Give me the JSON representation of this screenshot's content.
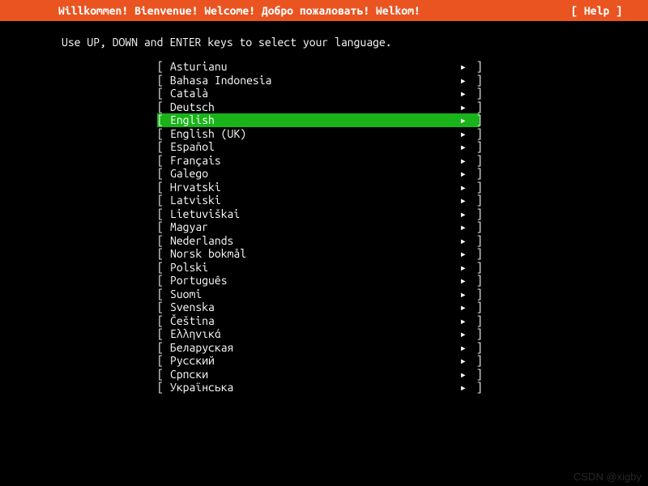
{
  "header": {
    "title": "Willkommen! Bienvenue! Welcome! Добро пожаловать! Welkom!",
    "help": "[ Help ]"
  },
  "instruction": "Use UP, DOWN and ENTER keys to select your language.",
  "selected_index": 4,
  "bracket_open": "[ ",
  "bracket_close": "]",
  "arrow_glyph": "▸",
  "languages": [
    "Asturianu",
    "Bahasa Indonesia",
    "Català",
    "Deutsch",
    "English",
    "English (UK)",
    "Español",
    "Français",
    "Galego",
    "Hrvatski",
    "Latviski",
    "Lietuviškai",
    "Magyar",
    "Nederlands",
    "Norsk bokmål",
    "Polski",
    "Português",
    "Suomi",
    "Svenska",
    "Čeština",
    "Ελληνικά",
    "Беларуская",
    "Русский",
    "Српски",
    "Українська"
  ],
  "watermark": "CSDN @xigby"
}
